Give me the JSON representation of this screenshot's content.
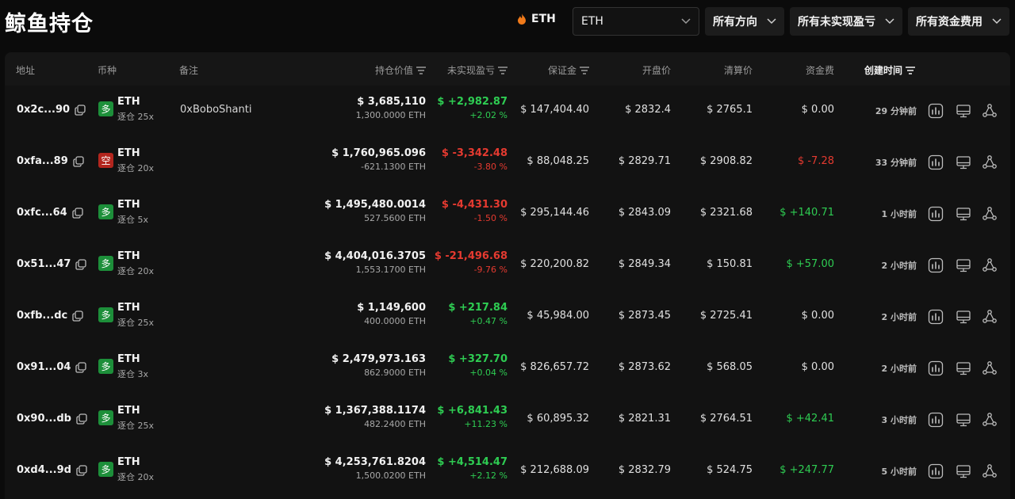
{
  "header": {
    "title": "鲸鱼持仓",
    "coin_tag": "ETH",
    "coin_select": "ETH",
    "direction_filter": "所有方向",
    "pnl_filter": "所有未实现盈亏",
    "fee_filter": "所有资金费用"
  },
  "columns": {
    "address": "地址",
    "coin": "币种",
    "note": "备注",
    "value": "持仓价值",
    "pnl": "未实现盈亏",
    "margin": "保证金",
    "open": "开盘价",
    "liq": "清算价",
    "funding": "资金费",
    "created": "创建时间"
  },
  "colors": {
    "long": "#1d8f3a",
    "short": "#b3261e",
    "profit": "#2ecc52",
    "loss": "#e53a30"
  },
  "rows": [
    {
      "address": "0x2c...90",
      "side": "多",
      "dir": "long",
      "coin": "ETH",
      "leverage": "逐仓 25x",
      "note": "0xBoboShanti",
      "value": "$ 3,685,110",
      "qty": "1,300.0000 ETH",
      "pnl": "$ +2,982.87",
      "pct": "+2.02 %",
      "pnl_sign": "pos",
      "margin": "$ 147,404.40",
      "open": "$ 2832.4",
      "liq": "$ 2765.1",
      "fee": "$ 0.00",
      "fee_sign": "zero",
      "time": "29 分钟前"
    },
    {
      "address": "0xfa...89",
      "side": "空",
      "dir": "short",
      "coin": "ETH",
      "leverage": "逐仓 20x",
      "note": "",
      "value": "$ 1,760,965.096",
      "qty": "-621.1300 ETH",
      "pnl": "$ -3,342.48",
      "pct": "-3.80 %",
      "pnl_sign": "neg",
      "margin": "$ 88,048.25",
      "open": "$ 2829.71",
      "liq": "$ 2908.82",
      "fee": "$ -7.28",
      "fee_sign": "neg",
      "time": "33 分钟前"
    },
    {
      "address": "0xfc...64",
      "side": "多",
      "dir": "long",
      "coin": "ETH",
      "leverage": "逐仓 5x",
      "note": "",
      "value": "$ 1,495,480.0014",
      "qty": "527.5600 ETH",
      "pnl": "$ -4,431.30",
      "pct": "-1.50 %",
      "pnl_sign": "neg",
      "margin": "$ 295,144.46",
      "open": "$ 2843.09",
      "liq": "$ 2321.68",
      "fee": "$ +140.71",
      "fee_sign": "pos",
      "time": "1 小时前"
    },
    {
      "address": "0x51...47",
      "side": "多",
      "dir": "long",
      "coin": "ETH",
      "leverage": "逐仓 20x",
      "note": "",
      "value": "$ 4,404,016.3705",
      "qty": "1,553.1700 ETH",
      "pnl": "$ -21,496.68",
      "pct": "-9.76 %",
      "pnl_sign": "neg",
      "margin": "$ 220,200.82",
      "open": "$ 2849.34",
      "liq": "$ 150.81",
      "fee": "$ +57.00",
      "fee_sign": "pos",
      "time": "2 小时前"
    },
    {
      "address": "0xfb...dc",
      "side": "多",
      "dir": "long",
      "coin": "ETH",
      "leverage": "逐仓 25x",
      "note": "",
      "value": "$ 1,149,600",
      "qty": "400.0000 ETH",
      "pnl": "$ +217.84",
      "pct": "+0.47 %",
      "pnl_sign": "pos",
      "margin": "$ 45,984.00",
      "open": "$ 2873.45",
      "liq": "$ 2725.41",
      "fee": "$ 0.00",
      "fee_sign": "zero",
      "time": "2 小时前"
    },
    {
      "address": "0x91...04",
      "side": "多",
      "dir": "long",
      "coin": "ETH",
      "leverage": "逐仓 3x",
      "note": "",
      "value": "$ 2,479,973.163",
      "qty": "862.9000 ETH",
      "pnl": "$ +327.70",
      "pct": "+0.04 %",
      "pnl_sign": "pos",
      "margin": "$ 826,657.72",
      "open": "$ 2873.62",
      "liq": "$ 568.05",
      "fee": "$ 0.00",
      "fee_sign": "zero",
      "time": "2 小时前"
    },
    {
      "address": "0x90...db",
      "side": "多",
      "dir": "long",
      "coin": "ETH",
      "leverage": "逐仓 25x",
      "note": "",
      "value": "$ 1,367,388.1174",
      "qty": "482.2400 ETH",
      "pnl": "$ +6,841.43",
      "pct": "+11.23 %",
      "pnl_sign": "pos",
      "margin": "$ 60,895.32",
      "open": "$ 2821.31",
      "liq": "$ 2764.51",
      "fee": "$ +42.41",
      "fee_sign": "pos",
      "time": "3 小时前"
    },
    {
      "address": "0xd4...9d",
      "side": "多",
      "dir": "long",
      "coin": "ETH",
      "leverage": "逐仓 20x",
      "note": "",
      "value": "$ 4,253,761.8204",
      "qty": "1,500.0200 ETH",
      "pnl": "$ +4,514.47",
      "pct": "+2.12 %",
      "pnl_sign": "pos",
      "margin": "$ 212,688.09",
      "open": "$ 2832.79",
      "liq": "$ 524.75",
      "fee": "$ +247.77",
      "fee_sign": "pos",
      "time": "5 小时前"
    }
  ]
}
